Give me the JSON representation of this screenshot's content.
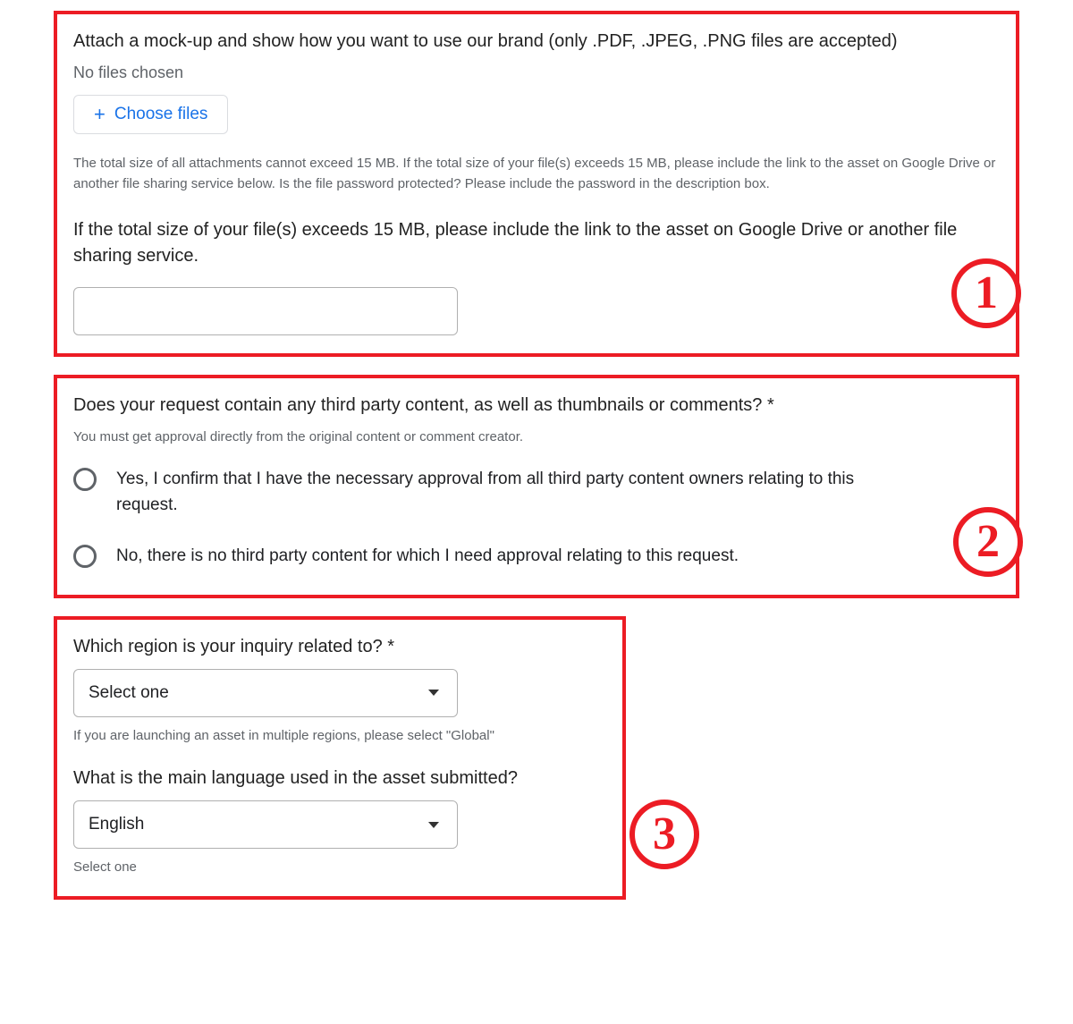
{
  "section1": {
    "attach_title": "Attach a mock-up and show how you want to use our brand (only .PDF, .JPEG, .PNG files are accepted)",
    "no_files": "No files chosen",
    "choose_plus": "+",
    "choose_label": "Choose files",
    "size_help": "The total size of all attachments cannot exceed 15 MB. If the total size of your file(s) exceeds 15 MB, please include the link to the asset on Google Drive or another file sharing service below. Is the file password protected? Please include the password in the description box.",
    "link_title": "If the total size of your file(s) exceeds 15 MB, please include the link to the asset on Google Drive or another file sharing service.",
    "badge": "1"
  },
  "section2": {
    "title": "Does your request contain any third party content, as well as thumbnails or comments? *",
    "help": "You must get approval directly from the original content or comment creator.",
    "option_yes": "Yes, I confirm that I have the necessary approval from all third party content owners relating to this request.",
    "option_no": "No, there is no third party content for which I need approval relating to this request.",
    "badge": "2"
  },
  "section3": {
    "region_title": "Which region is your inquiry related to? *",
    "region_value": "Select one",
    "region_help": "If you are launching an asset in multiple regions, please select \"Global\"",
    "language_title": "What is the main language used in the asset submitted?",
    "language_value": "English",
    "language_help": "Select one",
    "badge": "3"
  }
}
